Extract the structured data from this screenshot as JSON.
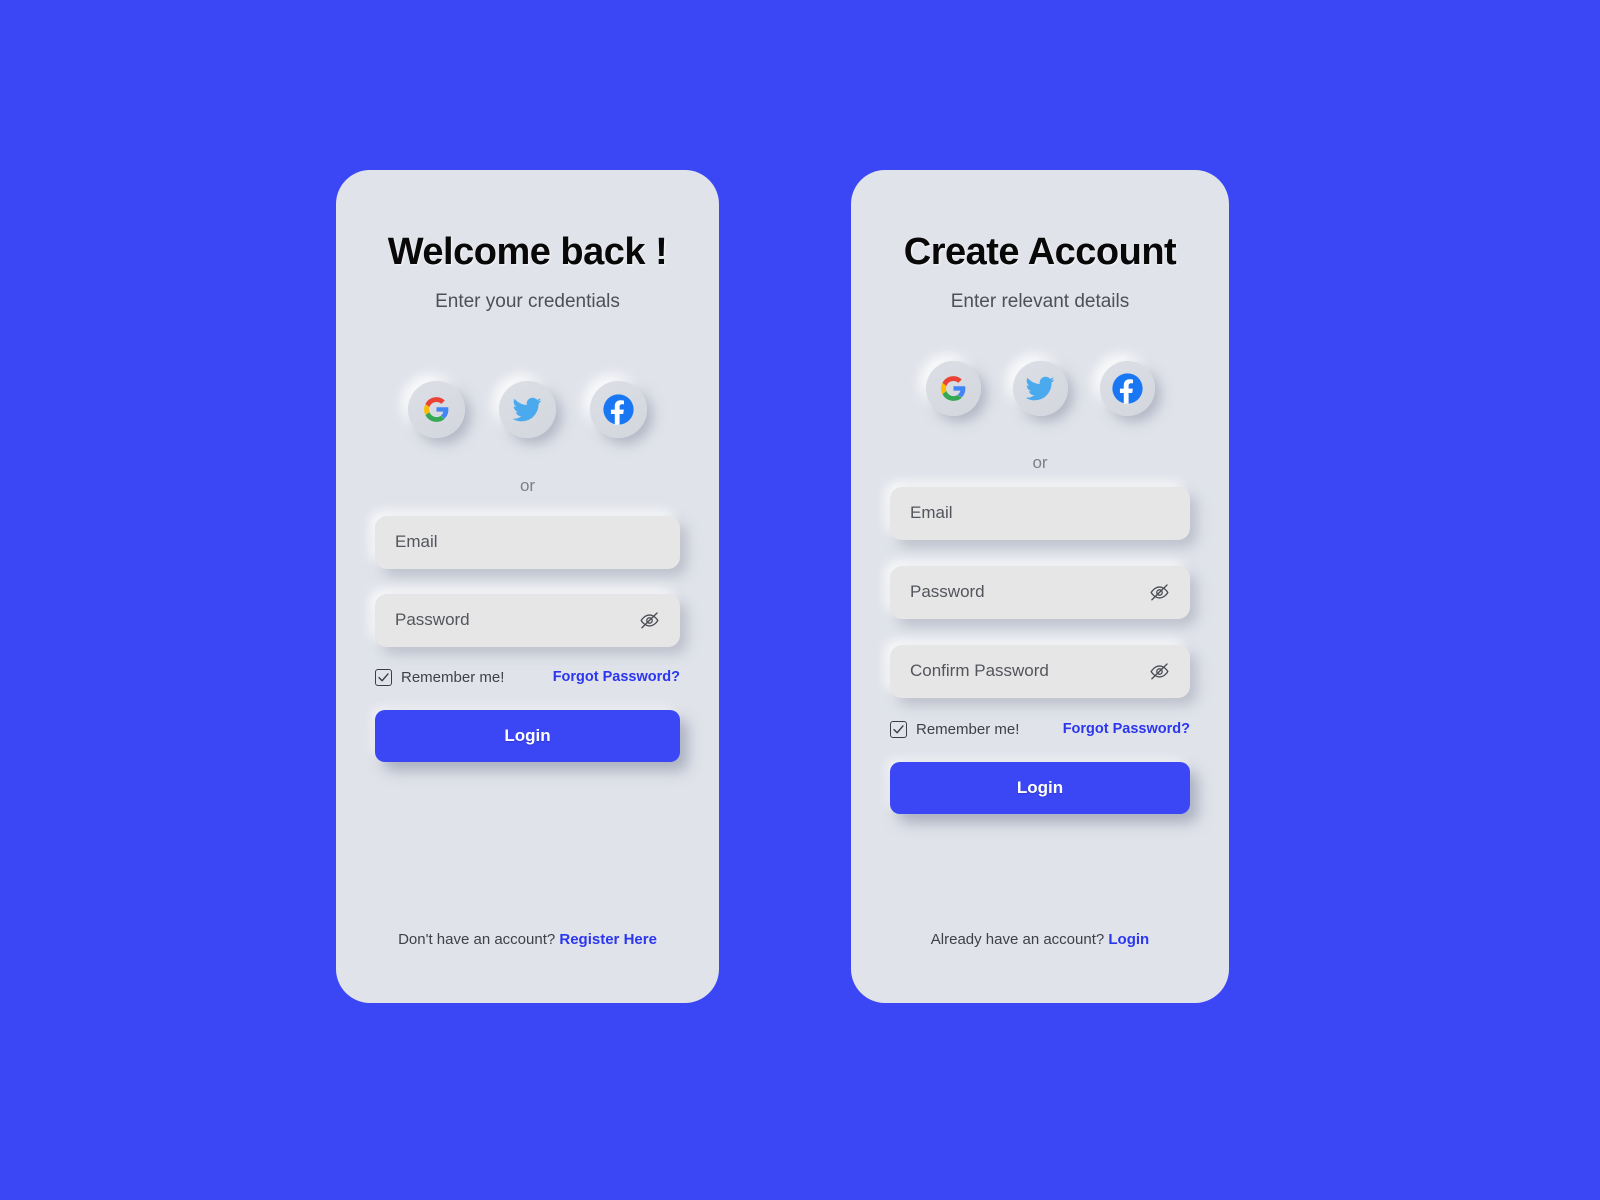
{
  "theme": {
    "background": "#3B46F5",
    "card_background": "#E0E3EA",
    "accent": "#2B36EE",
    "button": "#3B46F5",
    "field_background": "#E6E6E6",
    "title_color": "#080808",
    "muted_text": "#4E5057"
  },
  "login_card": {
    "title": "Welcome back !",
    "subtitle": "Enter your credentials",
    "social": [
      {
        "name": "google-signin-button",
        "icon": "google-icon",
        "label": "Google"
      },
      {
        "name": "twitter-signin-button",
        "icon": "twitter-icon",
        "label": "Twitter"
      },
      {
        "name": "facebook-signin-button",
        "icon": "facebook-icon",
        "label": "Facebook"
      }
    ],
    "divider_text": "or",
    "fields": [
      {
        "name": "email-field",
        "placeholder": "Email",
        "value": "",
        "has_eye": false
      },
      {
        "name": "password-field",
        "placeholder": "Password",
        "value": "",
        "has_eye": true,
        "eye_icon": "eye-off-icon"
      }
    ],
    "remember_label": "Remember me!",
    "remember_checked": true,
    "forgot_label": "Forgot Password?",
    "submit_label": "Login",
    "footer_text": "Don't have an account?",
    "footer_link": "Register Here"
  },
  "register_card": {
    "title": "Create Account",
    "subtitle": "Enter relevant details",
    "social": [
      {
        "name": "google-signin-button",
        "icon": "google-icon",
        "label": "Google"
      },
      {
        "name": "twitter-signin-button",
        "icon": "twitter-icon",
        "label": "Twitter"
      },
      {
        "name": "facebook-signin-button",
        "icon": "facebook-icon",
        "label": "Facebook"
      }
    ],
    "divider_text": "or",
    "fields": [
      {
        "name": "email-field",
        "placeholder": "Email",
        "value": "",
        "has_eye": false
      },
      {
        "name": "password-field",
        "placeholder": "Password",
        "value": "",
        "has_eye": true,
        "eye_icon": "eye-off-icon"
      },
      {
        "name": "confirm-password-field",
        "placeholder": "Confirm Password",
        "value": "",
        "has_eye": true,
        "eye_icon": "eye-off-icon"
      }
    ],
    "remember_label": "Remember me!",
    "remember_checked": true,
    "forgot_label": "Forgot Password?",
    "submit_label": "Login",
    "footer_text": "Already have an account?",
    "footer_link": "Login"
  }
}
